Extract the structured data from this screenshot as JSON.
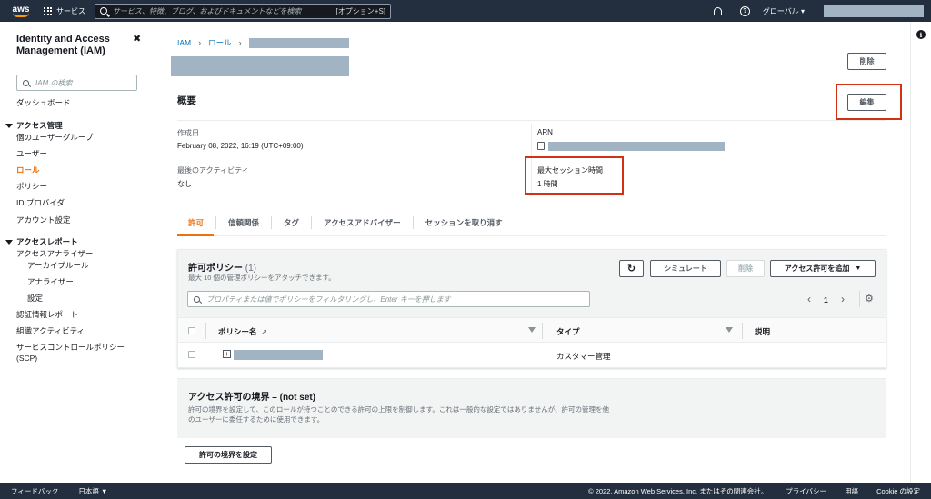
{
  "topnav": {
    "logo": "aws",
    "services": "サービス",
    "search_placeholder": "サービス、特徴、ブログ、およびドキュメントなどを検索",
    "search_shortcut": "[オプション+S]",
    "region": "グローバル",
    "icons": [
      "grid-icon",
      "search-icon",
      "bell-icon",
      "help-icon"
    ]
  },
  "sidebar": {
    "title": "Identity and Access Management (IAM)",
    "close": "✖",
    "search_placeholder": "IAM の検索",
    "dashboard": "ダッシュボード",
    "access_management": "アクセス管理",
    "user_groups": "個のユーザーグループ",
    "users": "ユーザー",
    "roles": "ロール",
    "policies": "ポリシー",
    "id_providers": "ID プロバイダ",
    "account_settings": "アカウント設定",
    "access_reports": "アクセスレポート",
    "access_analyzer": "アクセスアナライザー",
    "archive_rules": "アーカイブルール",
    "analyzers": "アナライザー",
    "settings": "設定",
    "credential_report": "認証情報レポート",
    "org_activity": "組織アクティビティ",
    "scp": "サービスコントロールポリシー (SCP)"
  },
  "breadcrumb": {
    "iam": "IAM",
    "roles": "ロール"
  },
  "buttons": {
    "delete": "削除",
    "edit": "編集"
  },
  "summary": {
    "title": "概要",
    "created_label": "作成日",
    "created_value": "February 08, 2022, 16:19 (UTC+09:00)",
    "arn_label": "ARN",
    "last_activity_label": "最後のアクティビティ",
    "last_activity_value": "なし",
    "max_session_label": "最大セッション時間",
    "max_session_value": "1 時間"
  },
  "tabs": [
    "許可",
    "信頼関係",
    "タグ",
    "アクセスアドバイザー",
    "セッションを取り消す"
  ],
  "policies_panel": {
    "title": "許可ポリシー",
    "count": "(1)",
    "subtitle": "最大 10 個の管理ポリシーをアタッチできます。",
    "refresh_icon": "refresh-icon",
    "simulate": "シミュレート",
    "remove": "削除",
    "add_permissions": "アクセス許可を追加",
    "filter_placeholder": "プロパティまたは値でポリシーをフィルタリングし、Enter キーを押します",
    "page": "1",
    "col_policy_name": "ポリシー名",
    "col_type": "タイプ",
    "col_description": "説明",
    "row_type": "カスタマー管理"
  },
  "boundary": {
    "title": "アクセス許可の境界 – (not set)",
    "desc": "許可の境界を設定して、このロールが持つことのできる許可の上限を制御します。これは一般的な設定ではありませんが、許可の管理を他のユーザーに委任するために使用できます。",
    "button": "許可の境界を設定"
  },
  "footer": {
    "feedback": "フィードバック",
    "language": "日本語",
    "copyright": "© 2022, Amazon Web Services, Inc. またはその関連会社。",
    "privacy": "プライバシー",
    "terms": "用語",
    "cookie": "Cookie の設定"
  },
  "colors": {
    "accent": "#ec7211",
    "link": "#0073bb",
    "nav": "#232f3e",
    "highlight": "#d13212",
    "redaction": "#a2b4c3"
  }
}
